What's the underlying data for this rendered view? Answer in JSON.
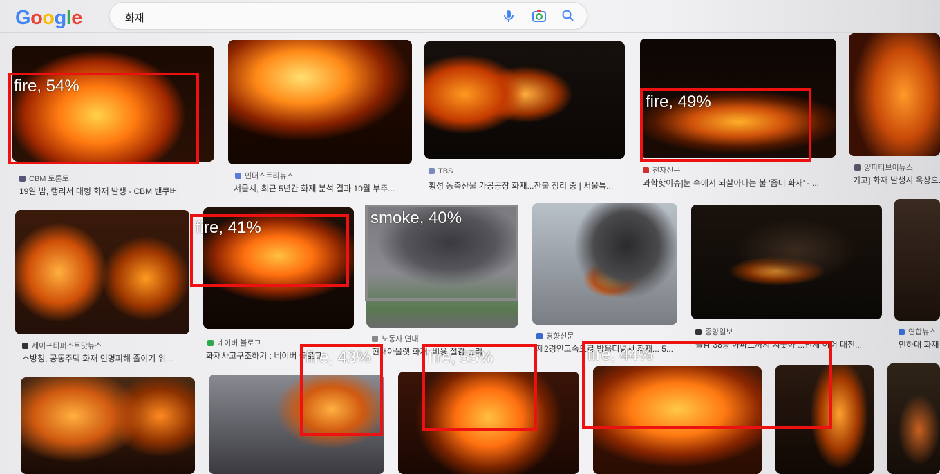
{
  "logo": [
    "G",
    "o",
    "o",
    "g",
    "l",
    "e"
  ],
  "logo_colors": [
    "#4285f4",
    "#ea4335",
    "#fbbc05",
    "#4285f4",
    "#34a853",
    "#ea4335"
  ],
  "search": {
    "query": "화재"
  },
  "row1": [
    {
      "source": "CBM 토론토",
      "caption": "19일 밤, 랭리서 대형 화재 발생 - CBM 밴쿠버"
    },
    {
      "source": "인더스트리뉴스",
      "caption": "서울시, 최근 5년간 화재 분석 결과 10월 부주..."
    },
    {
      "source": "TBS",
      "caption": "횡성 농축산물 가공공장 화재...잔불 정리 중 | 서울특..."
    },
    {
      "source": "전자신문",
      "caption": "과학핫이슈]눈 속에서 되살아나는 불 '좀비 화재' - ..."
    },
    {
      "source": "양파티브이뉴스",
      "caption": "기고] 화재 발생시 옥상으..."
    }
  ],
  "row2": [
    {
      "source": "세이프티퍼스트닷뉴스",
      "caption": "소방청, 공동주택 화재 인명피해 줄이기 위..."
    },
    {
      "source": "네이버 블로그",
      "caption": "화재사고구조하기 : 네이버 블로그"
    },
    {
      "source": "노동자 연대",
      "caption": "현대아울렛 화재: 비용 절감 논리..."
    },
    {
      "source": "경향신문",
      "caption": "제2경인고속도로 방음터널서 화재... 5..."
    },
    {
      "source": "중앙일보",
      "caption": "물감 38층 아파트까지 치솟아 ...인재 이어 대전..."
    },
    {
      "source": "연합뉴스",
      "caption": "인하대 화재"
    }
  ],
  "detections": [
    {
      "label": "fire, 54%"
    },
    {
      "label": "fire, 49%"
    },
    {
      "label": "fire, 41%"
    },
    {
      "label": "smoke, 40%"
    },
    {
      "label": "fire, 43%"
    },
    {
      "label": "fire, 55%"
    },
    {
      "label": "fire, 44%"
    }
  ]
}
